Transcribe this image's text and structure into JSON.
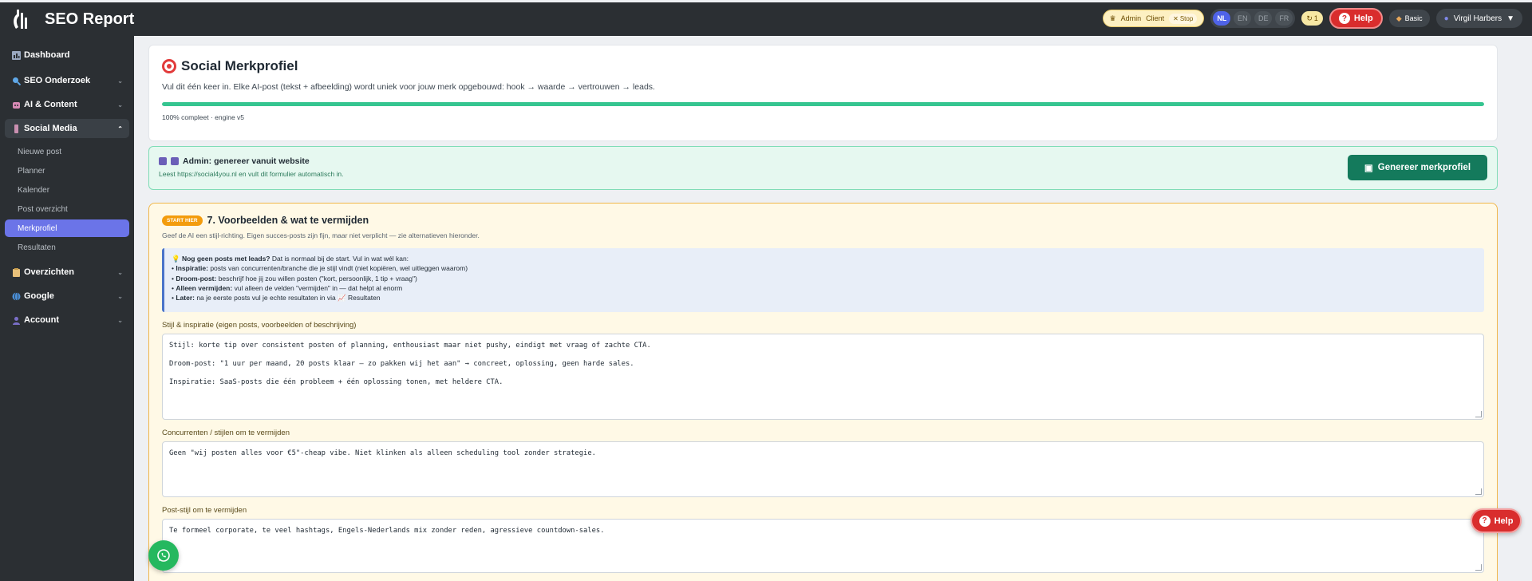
{
  "app": {
    "title": "SEO Report"
  },
  "topbar": {
    "admin_label": "Admin",
    "client_label": "Client",
    "stop_label": "Stop",
    "languages": [
      "NL",
      "EN",
      "DE",
      "FR"
    ],
    "active_language": "NL",
    "count": "1",
    "help_label": "Help",
    "plan_label": "Basic",
    "user_name": "Virgil Harbers"
  },
  "sidebar": {
    "items": [
      {
        "label": "Dashboard"
      },
      {
        "label": "SEO Onderzoek"
      },
      {
        "label": "AI & Content"
      },
      {
        "label": "Social Media"
      },
      {
        "label": "Overzichten"
      },
      {
        "label": "Google"
      },
      {
        "label": "Account"
      }
    ],
    "social_sub": [
      {
        "label": "Nieuwe post"
      },
      {
        "label": "Planner"
      },
      {
        "label": "Kalender"
      },
      {
        "label": "Post overzicht"
      },
      {
        "label": "Merkprofiel"
      },
      {
        "label": "Resultaten"
      }
    ]
  },
  "header": {
    "title": "Social Merkprofiel",
    "subtitle": "Vul dit één keer in. Elke AI-post (tekst + afbeelding) wordt uniek voor jouw merk opgebouwd: hook → waarde → vertrouwen → leads.",
    "progress_percent": 100,
    "progress_label": "100% compleet · engine v5"
  },
  "admin_card": {
    "title": "Admin: genereer vanuit website",
    "subtitle": "Leest https://social4you.nl en vult dit formulier automatisch in.",
    "button_label": "Genereer merkprofiel"
  },
  "section": {
    "badge": "START HIER",
    "title": "7. Voorbeelden & wat te vermijden",
    "subtitle": "Geef de AI een stijl-richting. Eigen succes-posts zijn fijn, maar niet verplicht — zie alternatieven hieronder.",
    "tip": {
      "head_bold": "Nog geen posts met leads?",
      "head_rest": " Dat is normaal bij de start. Vul in wat wél kan:",
      "lines": [
        {
          "bold": "Inspiratie:",
          "text": " posts van concurrenten/branche die je stijl vindt (niet kopiëren, wel uitleggen waarom)"
        },
        {
          "bold": "Droom-post:",
          "text": " beschrijf hoe jij zou willen posten (\"kort, persoonlijk, 1 tip + vraag\")"
        },
        {
          "bold": "Alleen vermijden:",
          "text": " vul alleen de velden \"vermijden\" in — dat helpt al enorm"
        },
        {
          "bold": "Later:",
          "text": " na je eerste posts vul je echte resultaten in via 📈 Resultaten"
        }
      ]
    },
    "fields": [
      {
        "label": "Stijl & inspiratie (eigen posts, voorbeelden of beschrijving)",
        "lines": [
          "Stijl: korte tip over consistent posten of planning, enthousiast maar niet pushy, eindigt met vraag of zachte CTA.",
          "Droom-post: \"1 uur per maand, 20 posts klaar — zo pakken wij het aan\" → concreet, oplossing, geen harde sales.",
          "Inspiratie: SaaS-posts die één probleem + één oplossing tonen, met heldere CTA."
        ]
      },
      {
        "label": "Concurrenten / stijlen om te vermijden",
        "lines": [
          "Geen \"wij posten alles voor €5\"-cheap vibe. Niet klinken als alleen scheduling tool zonder strategie."
        ]
      },
      {
        "label": "Post-stijl om te vermijden",
        "lines": [
          "Te formeel corporate, te veel hashtags, Engels-Nederlands mix zonder reden, agressieve countdown-sales."
        ]
      }
    ]
  },
  "floating": {
    "help_label": "Help"
  },
  "colors": {
    "accent": "#6b74e8",
    "success": "#35c590",
    "danger": "#d92d2d",
    "primary_dark": "#147a5c",
    "warning": "#f39c0d"
  }
}
